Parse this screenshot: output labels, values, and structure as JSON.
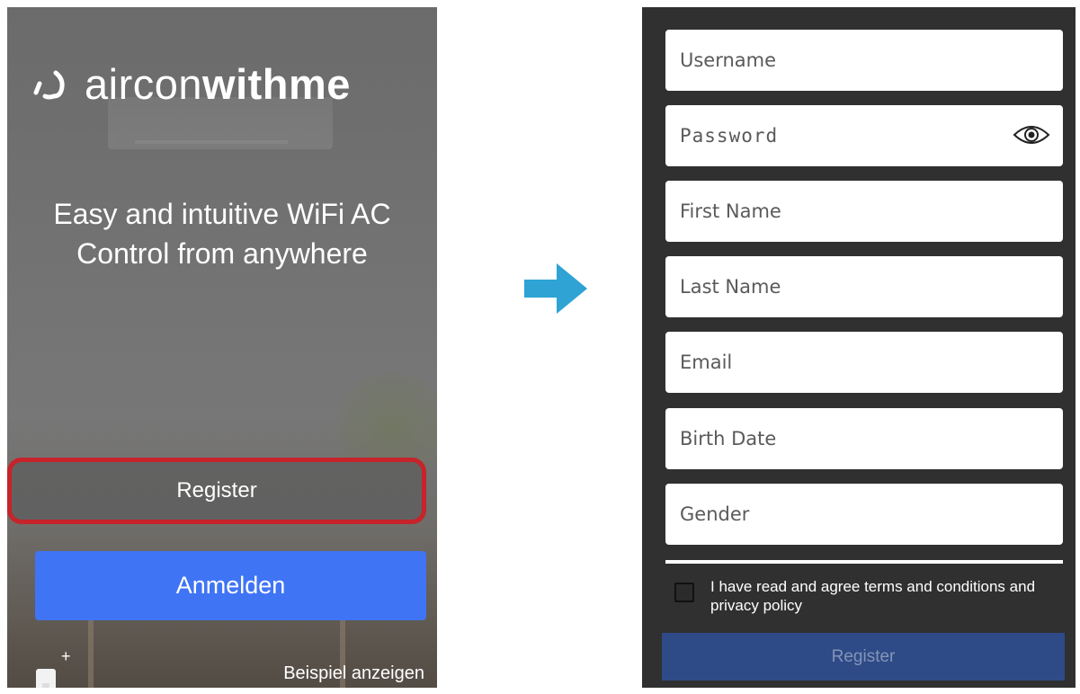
{
  "left_screen": {
    "logo": {
      "text_light": "aircon",
      "text_bold": "withme"
    },
    "tagline": [
      "Easy and intuitive WiFi AC",
      "Control from anywhere"
    ],
    "register_label": "Register",
    "login_label": "Anmelden",
    "demo_label": "Beispiel anzeigen",
    "add_device_symbol": "+"
  },
  "right_screen": {
    "fields": {
      "username": "Username",
      "password": "Password",
      "first_name": "First Name",
      "last_name": "Last Name",
      "email": "Email",
      "birth_date": "Birth Date",
      "gender": "Gender"
    },
    "terms_text": "I have read and agree terms and conditions and privacy policy",
    "register_label": "Register"
  },
  "colors": {
    "highlight": "#c6232a",
    "login_button": "#3f74f5",
    "register_button_disabled": "#2e4b88",
    "arrow": "#2ea3d4",
    "form_background": "#303030"
  },
  "icons": {
    "logo": "airconwithme-logo-icon",
    "eye": "eye-icon",
    "add_device": "add-device-icon",
    "arrow": "arrow-right-icon"
  }
}
